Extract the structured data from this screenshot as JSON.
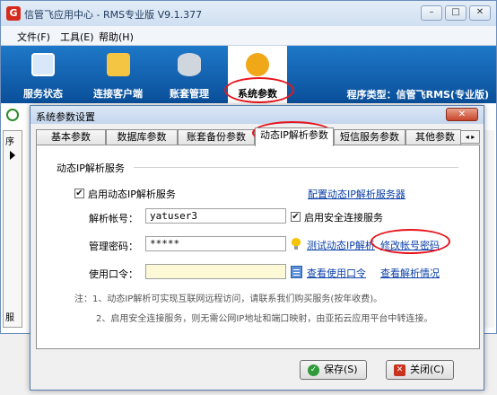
{
  "main": {
    "title": "信管飞应用中心 - RMS专业版 V9.1.377",
    "window_controls": [
      "–",
      "□",
      "✕"
    ],
    "menu": [
      "文件(F)",
      "工具(E)",
      "帮助(H)"
    ],
    "toolbar": {
      "items": [
        "服务状态",
        "连接客户端",
        "账套管理",
        "系统参数"
      ],
      "active": "系统参数",
      "program_type": "程序类型：信管飞RMS(专业版)"
    },
    "grid_header_char": "序",
    "left_char": "服"
  },
  "dialog": {
    "title": "系统参数设置",
    "close_label": "✕",
    "tabs": [
      "基本参数",
      "数据库参数",
      "账套备份参数",
      "动态IP解析参数",
      "短信服务参数",
      "其他参数"
    ],
    "active_tab": "动态IP解析参数",
    "tab_scroll": "◂ ▸",
    "group_title": "动态IP解析服务",
    "enable_service": {
      "label": "启用动态IP解析服务",
      "checked": true
    },
    "configure_link": "配置动态IP解析服务器",
    "account_label": "解析帐号：",
    "account_value": "yatuser3",
    "secure_conn": {
      "label": "启用安全连接服务",
      "checked": true
    },
    "password_label": "管理密码：",
    "password_value": "*****",
    "test_link": "测试动态IP解析",
    "modify_link": "修改帐号密码",
    "token_label": "使用口令：",
    "token_value": "",
    "view_token_link": "查看使用口令",
    "view_status_link": "查看解析情况",
    "note1": "注：1、动态IP解析可实现互联网远程访问，请联系我们购买服务(按年收费)。",
    "note2": "2、启用安全连接服务，则无需公网IP地址和端口映射，由亚拓云应用平台中转连接。",
    "save_button": "保存(S)",
    "close_button": "关闭(C)"
  },
  "colors": {
    "toolbar_blue": "#0a4f9a",
    "highlight_red": "#e8141b",
    "link_blue": "#0b3fa8"
  }
}
